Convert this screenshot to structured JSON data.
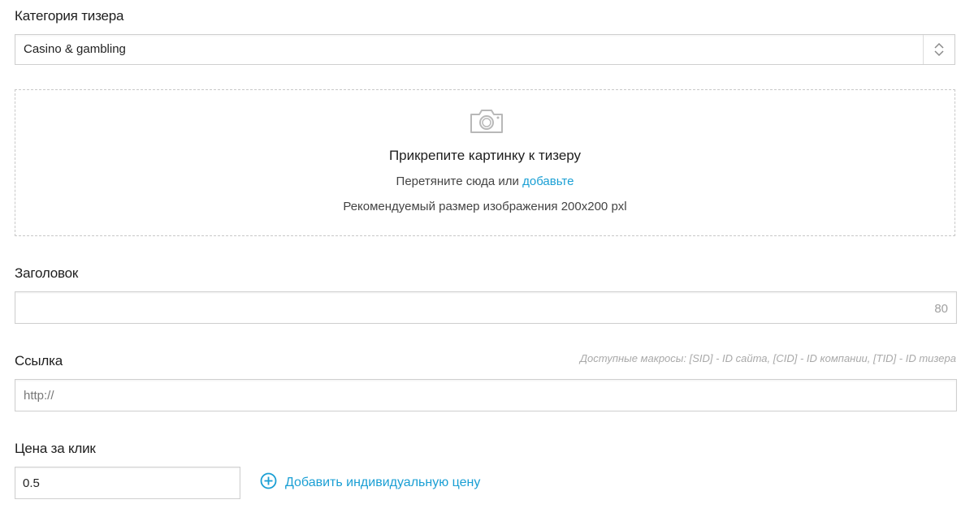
{
  "category": {
    "label": "Категория тизера",
    "selected": "Casino & gambling",
    "icon": "up-down-chevron-icon"
  },
  "upload": {
    "icon": "camera-icon",
    "title": "Прикрепите картинку к тизеру",
    "drag_text": "Перетяните сюда или",
    "add_link": "добавьте",
    "size_note": "Рекомендуемый размер изображения 200x200 pxl"
  },
  "headline": {
    "label": "Заголовок",
    "value": "",
    "char_limit": "80"
  },
  "link": {
    "label": "Ссылка",
    "macros_hint": "Доступные макросы: [SID] - ID сайта, [CID] - ID компании, [TID] - ID тизера",
    "placeholder": "http://",
    "value": ""
  },
  "price": {
    "label": "Цена за клик",
    "value": "0.5",
    "add_individual": "Добавить индивидуальную цену",
    "add_icon": "plus-circle-icon"
  },
  "colors": {
    "accent": "#1a9fd4",
    "border": "#cfcfcf",
    "muted_text": "#a9a9a9"
  }
}
